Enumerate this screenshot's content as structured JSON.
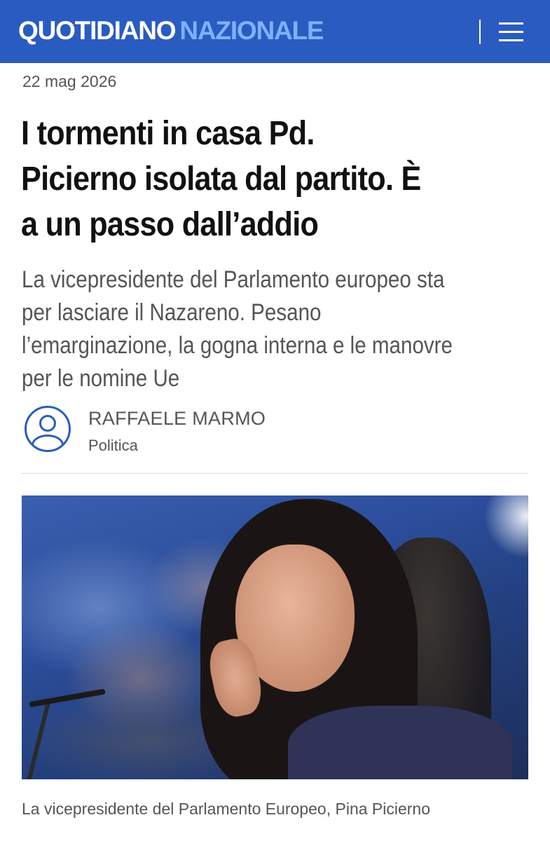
{
  "header": {
    "logo_part1": "QUOTIDIANO",
    "logo_part2": "NAZIONALE",
    "menu_icon": "hamburger-menu-icon",
    "brand_color": "#2a5bc0"
  },
  "article": {
    "date": "22 mag 2026",
    "headline_lines": [
      "I tormenti in casa Pd.",
      "Picierno isolata dal partito. È",
      "a un passo dall’addio"
    ],
    "subtitle_lines": [
      "La vicepresidente del Parlamento europeo sta",
      "per lasciare il Nazareno. Pesano",
      "l’emarginazione, la gogna interna e le manovre",
      "per le nomine Ue"
    ],
    "author": {
      "name": "RAFFAELE MARMO",
      "section": "Politica",
      "avatar_icon": "user-avatar-icon"
    },
    "image": {
      "caption": "La vicepresidente del Parlamento Europeo, Pina Picierno"
    }
  }
}
